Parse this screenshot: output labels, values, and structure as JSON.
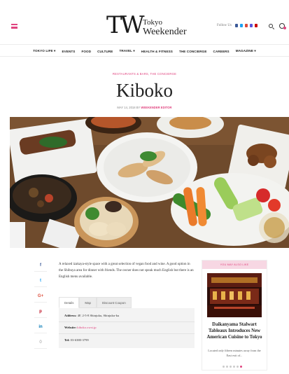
{
  "header": {
    "logo_mark": "TW",
    "logo_line1": "Tokyo",
    "logo_line2": "Weekender",
    "follow_label": "Follow Us"
  },
  "colors": {
    "accent": "#e0447f",
    "facebook": "#3b5998",
    "twitter": "#1da1f2",
    "googleplus": "#dd4b39",
    "pinterest": "#bd081c",
    "linkedin": "#0077b5"
  },
  "icons": [
    "menu-icon",
    "search-icon",
    "user-icon",
    "facebook-icon",
    "twitter-icon",
    "google-plus-icon",
    "pinterest-icon",
    "linkedin-icon",
    "comment-icon"
  ],
  "nav": [
    {
      "label": "TOKYO LIFE ▾"
    },
    {
      "label": "EVENTS"
    },
    {
      "label": "FOOD"
    },
    {
      "label": "CULTURE"
    },
    {
      "label": "TRAVEL ▾"
    },
    {
      "label": "HEALTH & FITNESS"
    },
    {
      "label": "THE CONCIERGE"
    },
    {
      "label": "CAREERS"
    },
    {
      "label": "MAGAZINE ▾"
    }
  ],
  "article": {
    "category": "RESTAURANTS & BARS, THE CONCIERGE",
    "title": "Kiboko",
    "date": "MAY 14, 2018 BY",
    "author": "WEEKENDER EDITOR",
    "body": "A relaxed izakaya-style space with a great selection of vegan food and wine. A good option in the Shibuya area for dinner with friends. The owner does not speak much English but there is an English menu available."
  },
  "share": {
    "facebook": "f",
    "twitter": "t",
    "googleplus": "G+",
    "pinterest": "p",
    "linkedin": "in",
    "comments": "0"
  },
  "tabs": [
    {
      "label": "Details"
    },
    {
      "label": "Map"
    },
    {
      "label": "Discount Coupon"
    }
  ],
  "details": {
    "address_label": "Address:",
    "address_value": "4F, 2-5-8 Shinjuku, Shinjuku-ku",
    "website_label": "Website:",
    "website_value": "kiboko.owst.jp",
    "tel_label": "Tel:",
    "tel_value": "03-6380-3799"
  },
  "sidebar": {
    "tag": "YOU MAY ALSO LIKE",
    "title": "Daikanyama Stalwart Tableaux Introduces New American Cuisine to Tokyo",
    "excerpt": "Located only fifteen minutes away from the East exit of...",
    "carousel_active": 5,
    "carousel_count": 6
  }
}
